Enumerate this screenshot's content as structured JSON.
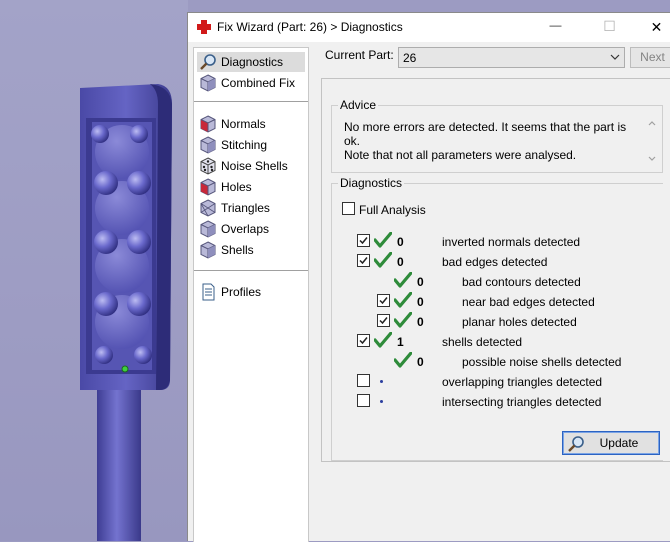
{
  "window": {
    "title": "Fix Wizard (Part: 26) > Diagnostics",
    "minimize_glyph": "—",
    "maximize_glyph": "☐",
    "close_glyph": "✕"
  },
  "nav": {
    "items": [
      {
        "label": "Diagnostics",
        "icon": "magnifier-icon",
        "selected": true
      },
      {
        "label": "Combined Fix",
        "icon": "cube-icon"
      },
      {
        "label": "Normals",
        "icon": "cube-red-face-icon"
      },
      {
        "label": "Stitching",
        "icon": "cube-icon"
      },
      {
        "label": "Noise Shells",
        "icon": "dice-icon"
      },
      {
        "label": "Holes",
        "icon": "cube-red-face-icon"
      },
      {
        "label": "Triangles",
        "icon": "triangle-cube-icon"
      },
      {
        "label": "Overlaps",
        "icon": "cube-icon"
      },
      {
        "label": "Shells",
        "icon": "cube-icon"
      },
      {
        "label": "Profiles",
        "icon": "document-icon"
      }
    ]
  },
  "current_part": {
    "label": "Current Part:",
    "value": "26"
  },
  "next_label": "Next",
  "advice": {
    "title": "Advice",
    "line1": "No more errors are detected. It seems that the part is ok.",
    "line2": "Note that not all parameters were analysed."
  },
  "diagnostics": {
    "title": "Diagnostics",
    "full_analysis_label": "Full Analysis",
    "full_analysis_checked": false,
    "rows": [
      {
        "label": "inverted normals detected",
        "count": "0",
        "checkbox": true,
        "checked": true,
        "status": "ok",
        "indent": 0
      },
      {
        "label": "bad edges detected",
        "count": "0",
        "checkbox": true,
        "checked": true,
        "status": "ok",
        "indent": 0
      },
      {
        "label": "bad contours detected",
        "count": "0",
        "checkbox": false,
        "checked": false,
        "status": "ok",
        "indent": 1
      },
      {
        "label": "near bad edges detected",
        "count": "0",
        "checkbox": true,
        "checked": true,
        "status": "ok",
        "indent": 1
      },
      {
        "label": "planar holes detected",
        "count": "0",
        "checkbox": true,
        "checked": true,
        "status": "ok",
        "indent": 1
      },
      {
        "label": "shells detected",
        "count": "1",
        "checkbox": true,
        "checked": true,
        "status": "ok",
        "indent": 0
      },
      {
        "label": "possible noise shells detected",
        "count": "0",
        "checkbox": false,
        "checked": false,
        "status": "ok",
        "indent": 1
      },
      {
        "label": "overlapping triangles detected",
        "count": "",
        "checkbox": true,
        "checked": false,
        "status": "pending",
        "indent": 0
      },
      {
        "label": "intersecting triangles detected",
        "count": "",
        "checkbox": true,
        "checked": false,
        "status": "pending",
        "indent": 0
      }
    ],
    "update_label": "Update"
  },
  "colors": {
    "accent": "#2c63c2",
    "ok_tick": "#2e8b3a",
    "model_body": "#5a59b8",
    "viewport_bg": "#9e9dc4"
  }
}
